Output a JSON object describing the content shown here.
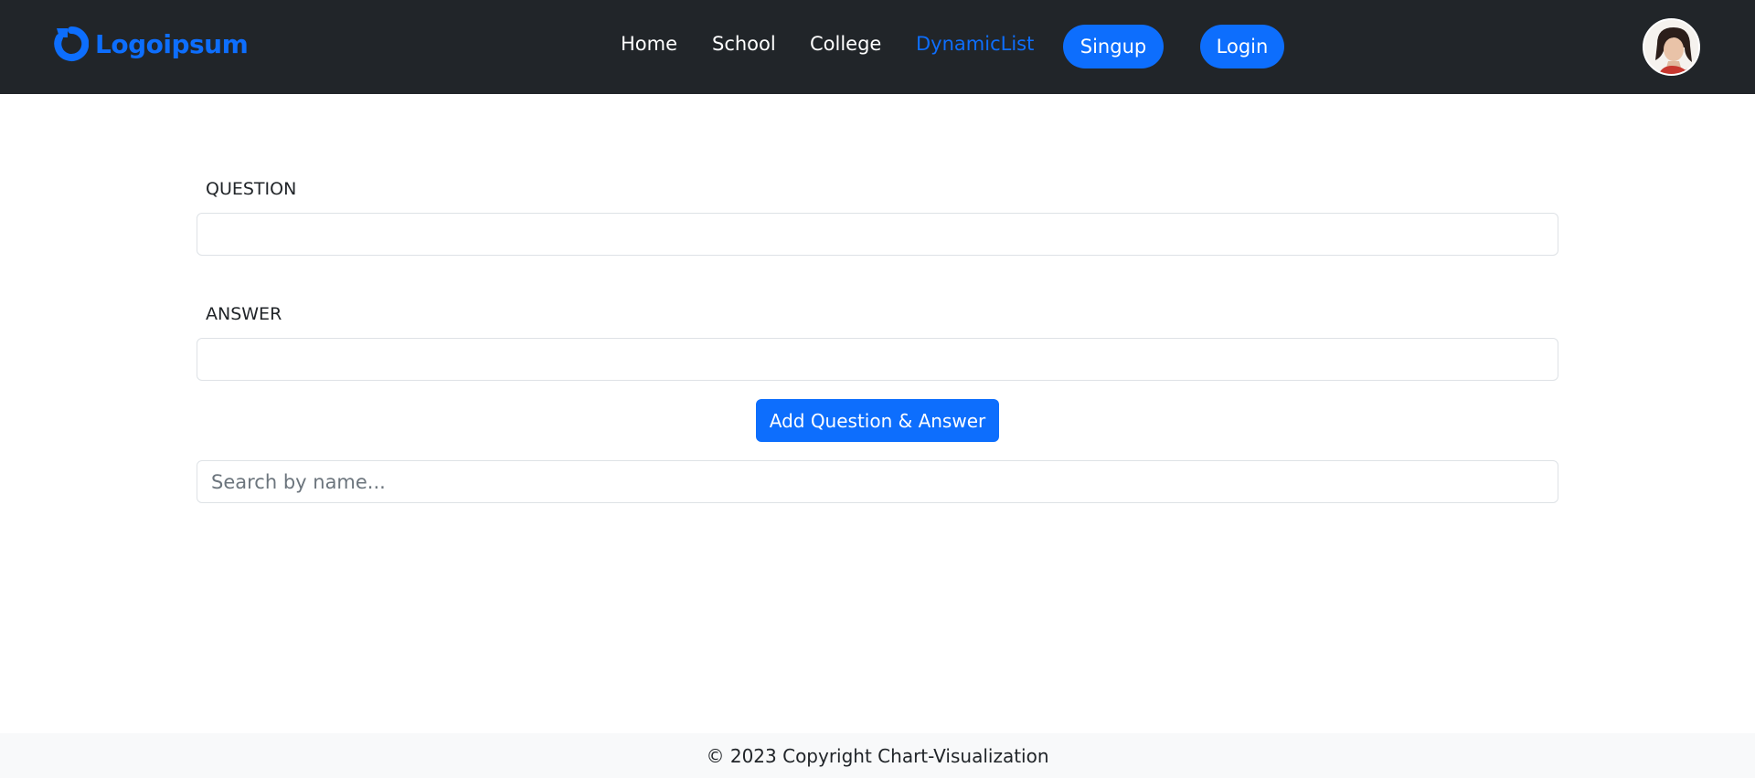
{
  "brand": {
    "name": "Logoipsum",
    "icon": "logoipsum-ring-icon",
    "color": "#0d6efd"
  },
  "nav": {
    "links": [
      {
        "label": "Home",
        "active": false
      },
      {
        "label": "School",
        "active": false
      },
      {
        "label": "College",
        "active": false
      },
      {
        "label": "DynamicList",
        "active": true
      }
    ],
    "signup_label": "Singup",
    "login_label": "Login",
    "avatar_icon": "user-avatar-photo"
  },
  "form": {
    "question_label": "QUESTION",
    "question_value": "",
    "answer_label": "ANSWER",
    "answer_value": "",
    "submit_label": "Add Question & Answer",
    "search_placeholder": "Search by name...",
    "search_value": ""
  },
  "footer": {
    "text": "© 2023 Copyright Chart-Visualization"
  },
  "colors": {
    "navbar_bg": "#212529",
    "accent": "#0d6efd",
    "footer_bg": "#f8f9fa"
  }
}
